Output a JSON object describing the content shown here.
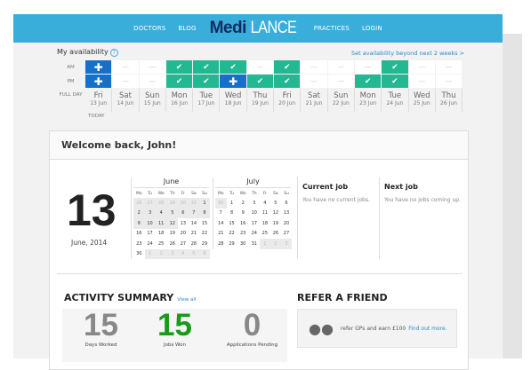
{
  "nav": {
    "items": [
      "DOCTORS",
      "BLOG"
    ],
    "items_right": [
      "PRACTICES",
      "LOGIN"
    ],
    "logo_a": "Medi",
    "logo_b": "LANCE"
  },
  "availability": {
    "title": "My availability",
    "help": "?",
    "link": "Set availability beyond next 2 weeks >",
    "row_labels": {
      "am": "AM",
      "pm": "PM",
      "full": "FULL DAY"
    },
    "today_label": "TODAY",
    "days": [
      {
        "name": "Fri",
        "date": "13 Jun",
        "am": "booked",
        "pm": "booked"
      },
      {
        "name": "Sat",
        "date": "14 Jun",
        "am": "none",
        "pm": "none"
      },
      {
        "name": "Sun",
        "date": "15 Jun",
        "am": "none",
        "pm": "none"
      },
      {
        "name": "Mon",
        "date": "16 Jun",
        "am": "available",
        "pm": "available"
      },
      {
        "name": "Tue",
        "date": "17 Jun",
        "am": "available",
        "pm": "available"
      },
      {
        "name": "Wed",
        "date": "18 Jun",
        "am": "available",
        "pm": "booked"
      },
      {
        "name": "Thu",
        "date": "19 Jun",
        "am": "none",
        "pm": "available"
      },
      {
        "name": "Fri",
        "date": "20 Jun",
        "am": "available",
        "pm": "available"
      },
      {
        "name": "Sat",
        "date": "21 Jun",
        "am": "none",
        "pm": "none"
      },
      {
        "name": "Sun",
        "date": "22 Jun",
        "am": "none",
        "pm": "none"
      },
      {
        "name": "Mon",
        "date": "23 Jun",
        "am": "none",
        "pm": "available"
      },
      {
        "name": "Tue",
        "date": "24 Jun",
        "am": "available",
        "pm": "available"
      },
      {
        "name": "Wed",
        "date": "25 Jun",
        "am": "none",
        "pm": "none"
      },
      {
        "name": "Thu",
        "date": "26 Jun",
        "am": "none",
        "pm": "none"
      }
    ],
    "colors": {
      "available": "#22b892",
      "booked": "#1470c8"
    }
  },
  "welcome": {
    "title": "Welcome back, John!",
    "day": "13",
    "month_year": "June, 2014"
  },
  "calendars": [
    {
      "month": "June",
      "weekdays": [
        "Mo",
        "Tu",
        "We",
        "Th",
        "Fr",
        "Sa",
        "Su"
      ],
      "weeks": [
        [
          [
            "26",
            "o"
          ],
          [
            "27",
            "o"
          ],
          [
            "28",
            "o"
          ],
          [
            "29",
            "o"
          ],
          [
            "30",
            "o"
          ],
          [
            "31",
            "o"
          ],
          [
            "1",
            "p"
          ]
        ],
        [
          [
            "2",
            "p"
          ],
          [
            "3",
            "p"
          ],
          [
            "4",
            "p"
          ],
          [
            "5",
            "p"
          ],
          [
            "6",
            "p"
          ],
          [
            "7",
            "p"
          ],
          [
            "8",
            "p"
          ]
        ],
        [
          [
            "9",
            "p"
          ],
          [
            "10",
            "p"
          ],
          [
            "11",
            "p"
          ],
          [
            "12",
            "p"
          ],
          [
            "13",
            ""
          ],
          [
            "14",
            ""
          ],
          [
            "15",
            ""
          ]
        ],
        [
          [
            "16",
            ""
          ],
          [
            "17",
            ""
          ],
          [
            "18",
            ""
          ],
          [
            "19",
            ""
          ],
          [
            "20",
            ""
          ],
          [
            "21",
            ""
          ],
          [
            "22",
            ""
          ]
        ],
        [
          [
            "23",
            ""
          ],
          [
            "24",
            ""
          ],
          [
            "25",
            ""
          ],
          [
            "26",
            ""
          ],
          [
            "27",
            ""
          ],
          [
            "28",
            ""
          ],
          [
            "29",
            ""
          ]
        ],
        [
          [
            "30",
            ""
          ],
          [
            "1",
            "o"
          ],
          [
            "2",
            "o"
          ],
          [
            "3",
            "o"
          ],
          [
            "4",
            "o"
          ],
          [
            "5",
            "o"
          ],
          [
            "6",
            "o"
          ]
        ]
      ]
    },
    {
      "month": "July",
      "weekdays": [
        "Mo",
        "Tu",
        "We",
        "Th",
        "Fr",
        "Sa",
        "Su"
      ],
      "weeks": [
        [
          [
            "30",
            "o"
          ],
          [
            "1",
            ""
          ],
          [
            "2",
            ""
          ],
          [
            "3",
            ""
          ],
          [
            "4",
            ""
          ],
          [
            "5",
            ""
          ],
          [
            "6",
            ""
          ]
        ],
        [
          [
            "7",
            ""
          ],
          [
            "8",
            ""
          ],
          [
            "9",
            ""
          ],
          [
            "10",
            ""
          ],
          [
            "11",
            ""
          ],
          [
            "12",
            ""
          ],
          [
            "13",
            ""
          ]
        ],
        [
          [
            "14",
            ""
          ],
          [
            "15",
            ""
          ],
          [
            "16",
            ""
          ],
          [
            "17",
            ""
          ],
          [
            "18",
            ""
          ],
          [
            "19",
            ""
          ],
          [
            "20",
            ""
          ]
        ],
        [
          [
            "21",
            ""
          ],
          [
            "22",
            ""
          ],
          [
            "23",
            ""
          ],
          [
            "24",
            ""
          ],
          [
            "25",
            ""
          ],
          [
            "26",
            ""
          ],
          [
            "27",
            ""
          ]
        ],
        [
          [
            "28",
            ""
          ],
          [
            "29",
            ""
          ],
          [
            "30",
            ""
          ],
          [
            "31",
            ""
          ],
          [
            "1",
            "o"
          ],
          [
            "2",
            "o"
          ],
          [
            "3",
            "o"
          ]
        ]
      ]
    }
  ],
  "current_job": {
    "title": "Current job",
    "text": "You have no current jobs."
  },
  "next_job": {
    "title": "Next job",
    "text": "You have no jobs coming up."
  },
  "activity": {
    "title": "ACTIVITY SUMMARY",
    "view_all": "View all",
    "stats": [
      {
        "value": "15",
        "label": "Days Worked"
      },
      {
        "value": "15",
        "label": "Jobs Won"
      },
      {
        "value": "0",
        "label": "Applications Pending"
      }
    ]
  },
  "refer": {
    "title": "REFER A FRIEND",
    "text": "refer GPs and earn £100",
    "link": "Find out more."
  }
}
